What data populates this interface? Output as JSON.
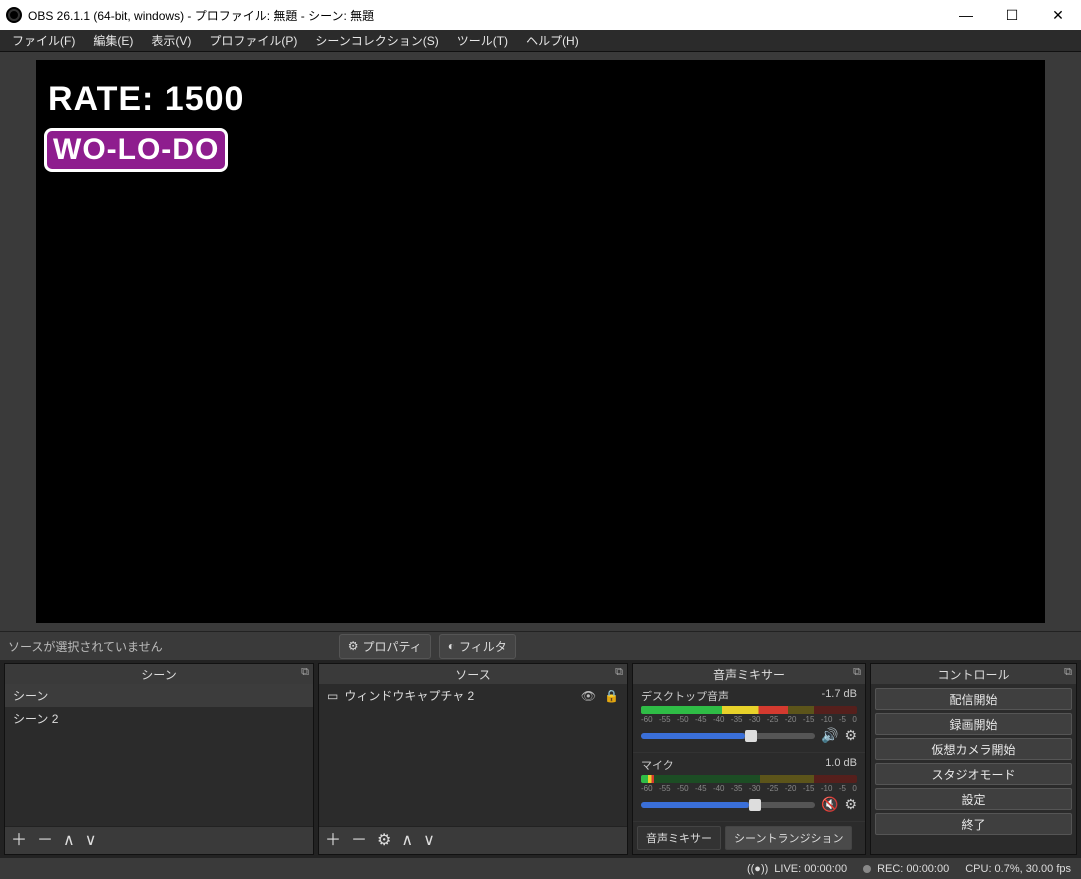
{
  "window": {
    "title": "OBS 26.1.1 (64-bit, windows) - プロファイル: 無題 - シーン: 無題"
  },
  "menubar": {
    "file": "ファイル(F)",
    "edit": "編集(E)",
    "view": "表示(V)",
    "profile": "プロファイル(P)",
    "scene_collection": "シーンコレクション(S)",
    "tools": "ツール(T)",
    "help": "ヘルプ(H)"
  },
  "preview": {
    "rate_text": "RATE: 1500",
    "wolodo_text": "WO-LO-DO"
  },
  "preview_toolbar": {
    "hint": "ソースが選択されていません",
    "properties_label": "プロパティ",
    "filters_label": "フィルタ"
  },
  "docks": {
    "scenes": {
      "title": "シーン",
      "items": [
        {
          "label": "シーン"
        },
        {
          "label": "シーン 2"
        }
      ]
    },
    "sources": {
      "title": "ソース",
      "items": [
        {
          "label": "ウィンドウキャプチャ 2",
          "visible_icon": "eye",
          "lock_icon": "lock"
        }
      ]
    },
    "mixer": {
      "title": "音声ミキサー",
      "channels": [
        {
          "name": "デスクトップ音声",
          "db": "-1.7 dB",
          "fill_pct": 68,
          "slider_pct": 60,
          "muted": false
        },
        {
          "name": "マイク",
          "db": "1.0 dB",
          "fill_pct": 6,
          "slider_pct": 62,
          "muted": true
        }
      ],
      "scale_labels": [
        "-60",
        "-55",
        "-50",
        "-45",
        "-40",
        "-35",
        "-30",
        "-25",
        "-20",
        "-15",
        "-10",
        "-5",
        "0"
      ],
      "tabs": {
        "mixer": "音声ミキサー",
        "transitions": "シーントランジション"
      }
    },
    "controls": {
      "title": "コントロール",
      "buttons": {
        "start_stream": "配信開始",
        "start_record": "録画開始",
        "virtual_cam": "仮想カメラ開始",
        "studio_mode": "スタジオモード",
        "settings": "設定",
        "exit": "終了"
      }
    }
  },
  "statusbar": {
    "live": "LIVE: 00:00:00",
    "rec": "REC: 00:00:00",
    "cpu": "CPU: 0.7%, 30.00 fps"
  }
}
